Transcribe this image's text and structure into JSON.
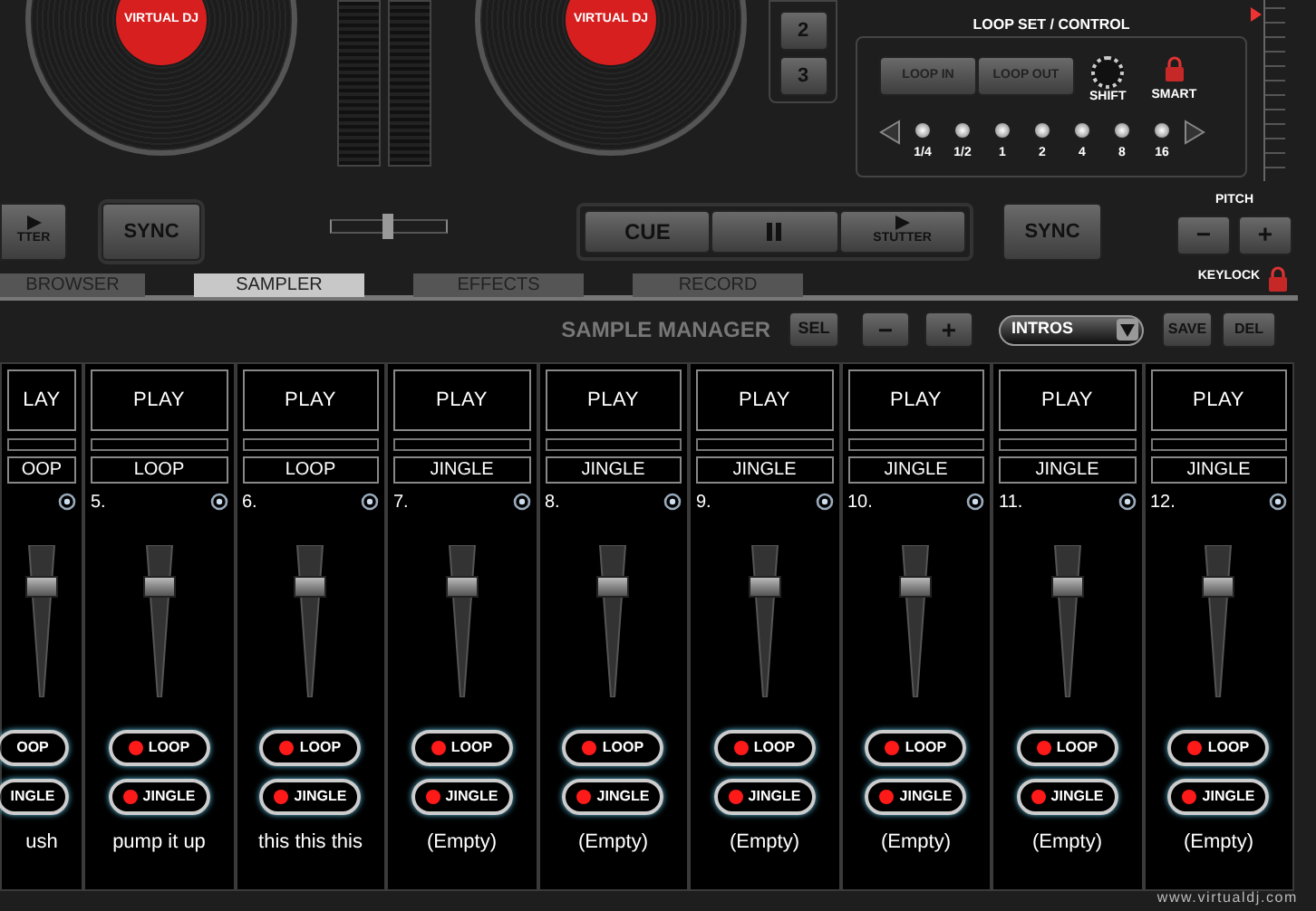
{
  "decks": {
    "platters": [
      {
        "label": "VIRTUAL DJ"
      },
      {
        "label": "VIRTUAL DJ"
      }
    ]
  },
  "hot_buttons": [
    "2",
    "3"
  ],
  "loop_panel": {
    "title": "LOOP SET / CONTROL",
    "loop_in": "LOOP IN",
    "loop_out": "LOOP OUT",
    "shift_label": "SHIFT",
    "smart_label": "SMART",
    "sizes": [
      "1/4",
      "1/2",
      "1",
      "2",
      "4",
      "8",
      "16"
    ]
  },
  "transport": {
    "left_stutter": "TTER",
    "left_sync": "SYNC",
    "cue": "CUE",
    "stutter": "STUTTER",
    "right_sync": "SYNC"
  },
  "pitch": {
    "level": 0.96,
    "label": "PITCH",
    "minus": "−",
    "plus": "+",
    "keylock": "KEYLOCK"
  },
  "tabs": [
    {
      "label": "BROWSER",
      "selected": false
    },
    {
      "label": "SAMPLER",
      "selected": true
    },
    {
      "label": "EFFECTS",
      "selected": false
    },
    {
      "label": "RECORD",
      "selected": false
    }
  ],
  "sample_manager": {
    "title": "SAMPLE MANAGER",
    "sel": "SEL",
    "minus": "−",
    "plus": "+",
    "bank": "INTROS",
    "save": "SAVE",
    "del": "DEL"
  },
  "slots": [
    {
      "play": "LAY",
      "type": "OOP",
      "loop": "OOP",
      "jingle": "INGLE",
      "name": "ush",
      "fader": {
        "level": 0.76
      }
    },
    {
      "number": "5.",
      "play": "PLAY",
      "type": "LOOP",
      "loop": "LOOP",
      "jingle": "JINGLE",
      "name": "pump it up",
      "fader": {
        "level": 0.76
      }
    },
    {
      "number": "6.",
      "play": "PLAY",
      "type": "LOOP",
      "loop": "LOOP",
      "jingle": "JINGLE",
      "name": "this this this",
      "fader": {
        "level": 0.76
      }
    },
    {
      "number": "7.",
      "play": "PLAY",
      "type": "JINGLE",
      "loop": "LOOP",
      "jingle": "JINGLE",
      "name": "(Empty)",
      "fader": {
        "level": 0.76
      }
    },
    {
      "number": "8.",
      "play": "PLAY",
      "type": "JINGLE",
      "loop": "LOOP",
      "jingle": "JINGLE",
      "name": "(Empty)",
      "fader": {
        "level": 0.76
      }
    },
    {
      "number": "9.",
      "play": "PLAY",
      "type": "JINGLE",
      "loop": "LOOP",
      "jingle": "JINGLE",
      "name": "(Empty)",
      "fader": {
        "level": 0.76
      }
    },
    {
      "number": "10.",
      "play": "PLAY",
      "type": "JINGLE",
      "loop": "LOOP",
      "jingle": "JINGLE",
      "name": "(Empty)",
      "fader": {
        "level": 0.76
      }
    },
    {
      "number": "11.",
      "play": "PLAY",
      "type": "JINGLE",
      "loop": "LOOP",
      "jingle": "JINGLE",
      "name": "(Empty)",
      "fader": {
        "level": 0.76
      }
    },
    {
      "number": "12.",
      "play": "PLAY",
      "type": "JINGLE",
      "loop": "LOOP",
      "jingle": "JINGLE",
      "name": "(Empty)",
      "fader": {
        "level": 0.76
      }
    }
  ],
  "footer": "www.virtualdj.com"
}
